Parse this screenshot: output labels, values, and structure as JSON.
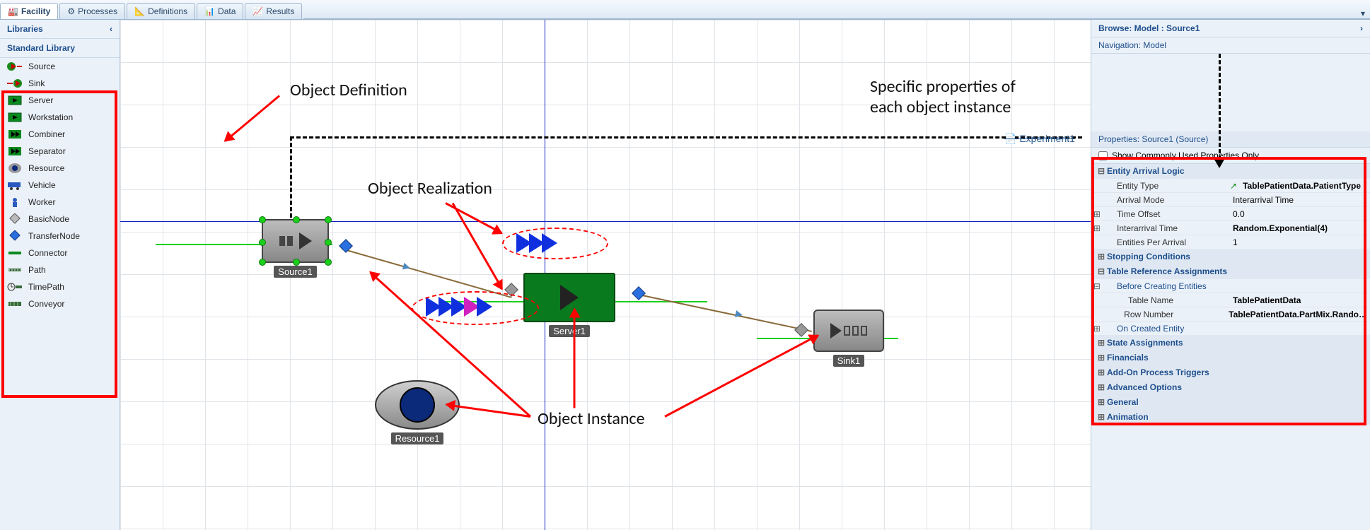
{
  "tabs": [
    {
      "label": "Facility",
      "active": true
    },
    {
      "label": "Processes",
      "active": false
    },
    {
      "label": "Definitions",
      "active": false
    },
    {
      "label": "Data",
      "active": false
    },
    {
      "label": "Results",
      "active": false
    }
  ],
  "sidebar": {
    "header": "Libraries",
    "section": "Standard Library",
    "items": [
      {
        "label": "Source"
      },
      {
        "label": "Sink"
      },
      {
        "label": "Server"
      },
      {
        "label": "Workstation"
      },
      {
        "label": "Combiner"
      },
      {
        "label": "Separator"
      },
      {
        "label": "Resource"
      },
      {
        "label": "Vehicle"
      },
      {
        "label": "Worker"
      },
      {
        "label": "BasicNode"
      },
      {
        "label": "TransferNode"
      },
      {
        "label": "Connector"
      },
      {
        "label": "Path"
      },
      {
        "label": "TimePath"
      },
      {
        "label": "Conveyor"
      }
    ]
  },
  "canvas": {
    "nodes": {
      "source": {
        "label": "Source1"
      },
      "server": {
        "label": "Server1"
      },
      "sink": {
        "label": "Sink1"
      },
      "resource": {
        "label": "Resource1"
      }
    },
    "experiment_label": "Experiment1"
  },
  "rightpanel": {
    "browse": "Browse: Model : Source1",
    "nav": "Navigation: Model",
    "props_header": "Properties: Source1 (Source)",
    "checkbox": "Show Commonly Used Properties Only",
    "sections": {
      "entity_arrival": "Entity Arrival Logic",
      "stopping": "Stopping Conditions",
      "table_ref": "Table Reference Assignments",
      "before_creating": "Before Creating Entities",
      "on_created": "On Created Entity",
      "state": "State Assignments",
      "financials": "Financials",
      "addon": "Add-On Process Triggers",
      "advanced": "Advanced Options",
      "general": "General",
      "animation": "Animation"
    },
    "rows": {
      "entity_type": {
        "name": "Entity Type",
        "value": "TablePatientData.PatientType"
      },
      "arrival_mode": {
        "name": "Arrival Mode",
        "value": "Interarrival Time"
      },
      "time_offset": {
        "name": "Time Offset",
        "value": "0.0"
      },
      "interarrival": {
        "name": "Interarrival Time",
        "value": "Random.Exponential(4)"
      },
      "entities_per": {
        "name": "Entities Per Arrival",
        "value": "1"
      },
      "table_name": {
        "name": "Table Name",
        "value": "TablePatientData"
      },
      "row_number": {
        "name": "Row Number",
        "value": "TablePatientData.PartMix.Rando…"
      }
    }
  },
  "annotations": {
    "def": "Object Definition",
    "real": "Object Realization",
    "inst": "Object Instance",
    "specific": "Specific properties of\neach object instance"
  }
}
